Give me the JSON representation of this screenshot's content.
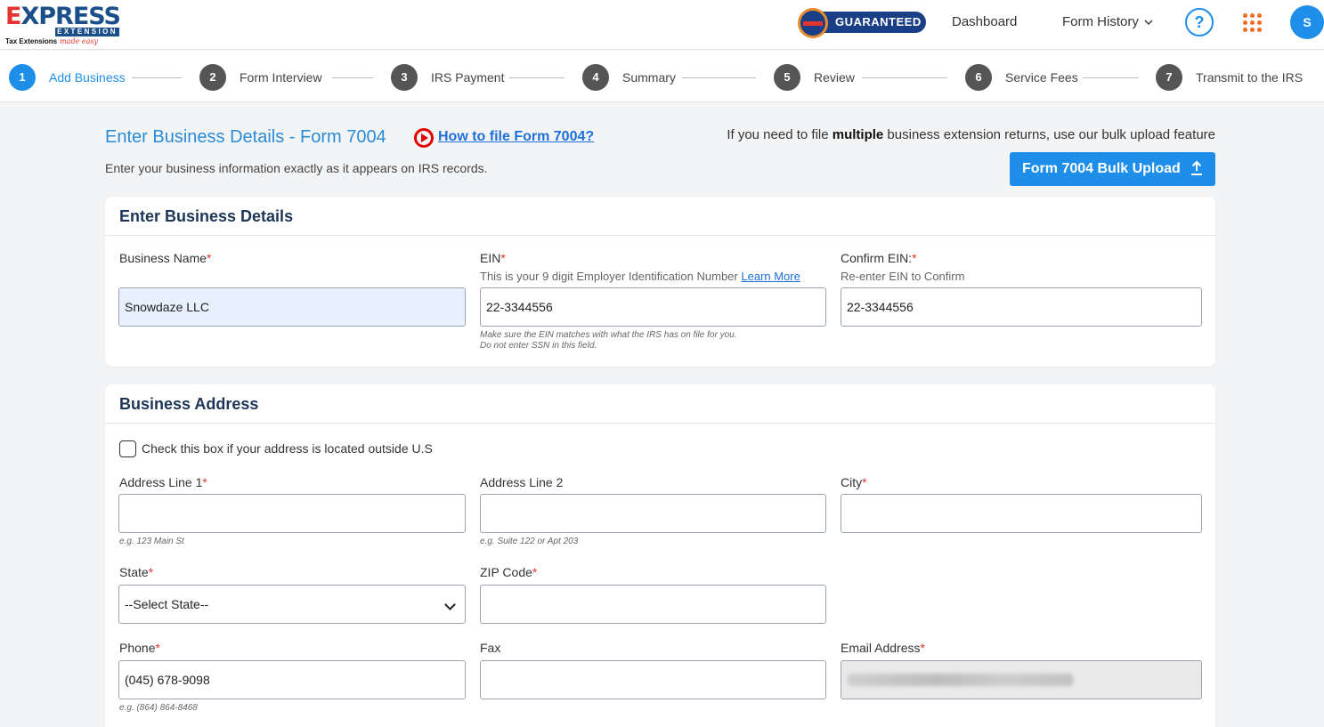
{
  "header": {
    "logo": {
      "main": "EXPRESS",
      "bar": "EXTENSION",
      "tagline": "Tax Extensions",
      "tagline_script": "made easy"
    },
    "badge": "GUARANTEED",
    "nav": {
      "dashboard": "Dashboard",
      "form_history": "Form History"
    },
    "help": "?",
    "avatar": "S"
  },
  "steps": [
    {
      "num": "1",
      "label": "Add Business"
    },
    {
      "num": "2",
      "label": "Form Interview"
    },
    {
      "num": "3",
      "label": "IRS Payment"
    },
    {
      "num": "4",
      "label": "Summary"
    },
    {
      "num": "5",
      "label": "Review"
    },
    {
      "num": "6",
      "label": "Service Fees"
    },
    {
      "num": "7",
      "label": "Transmit to the IRS"
    }
  ],
  "intro": {
    "title": "Enter Business Details - Form 7004",
    "howto": "How to file Form 7004?",
    "subtitle": "Enter your business information exactly as it appears on IRS records.",
    "bulk_note_pre": "If you need to file ",
    "bulk_note_bold": "multiple",
    "bulk_note_post": " business extension returns, use our bulk upload feature",
    "bulk_button": "Form 7004 Bulk Upload"
  },
  "business": {
    "heading": "Enter Business Details",
    "name_label": "Business Name",
    "name_value": "Snowdaze LLC",
    "ein_label": "EIN",
    "ein_help": "This is your 9 digit Employer Identification Number ",
    "ein_learn": "Learn More",
    "ein_value": "22-3344556",
    "ein_hint1": "Make sure the EIN matches with what the IRS has on file for you.",
    "ein_hint2": "Do not enter SSN in this field.",
    "confirm_label": "Confirm EIN:",
    "confirm_help": "Re-enter EIN to Confirm",
    "confirm_value": "22-3344556"
  },
  "address": {
    "heading": "Business Address",
    "outside_us": "Check this box if your address is located outside U.S",
    "line1_label": "Address Line 1",
    "line1_hint": "e.g. 123 Main St",
    "line2_label": "Address Line 2",
    "line2_hint": "e.g. Suite 122 or Apt 203",
    "city_label": "City",
    "state_label": "State",
    "state_value": "--Select State--",
    "zip_label": "ZIP Code",
    "phone_label": "Phone",
    "phone_value": "(045) 678-9098",
    "phone_hint": "e.g. (864) 864-8468",
    "fax_label": "Fax",
    "email_label": "Email Address"
  },
  "colors": {
    "accent": "#1e8ee9",
    "title": "#2a8bd6",
    "required": "#e3342f",
    "heading": "#1d3557"
  }
}
